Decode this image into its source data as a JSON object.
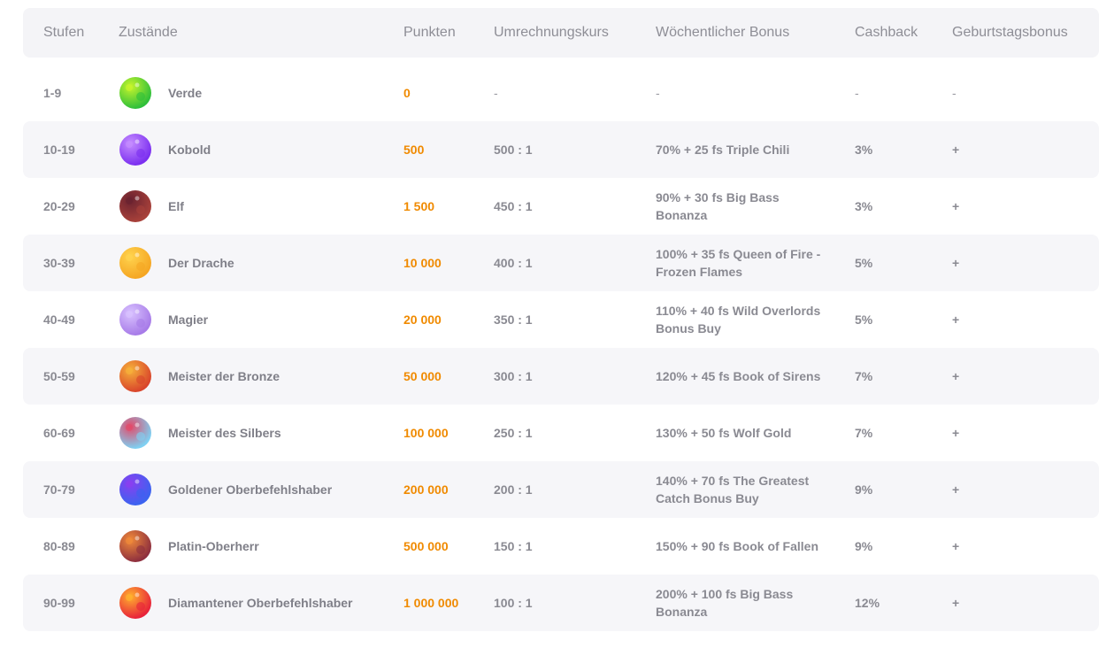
{
  "headers": {
    "level": "Stufen",
    "status": "Zustände",
    "points": "Punkten",
    "rate": "Umrechnungskurs",
    "weekly_bonus": "Wöchentlicher Bonus",
    "cashback": "Cashback",
    "birthday_bonus": "Geburtstagsbonus"
  },
  "rows": [
    {
      "level": "1-9",
      "name": "Verde",
      "points": "0",
      "rate": "-",
      "bonus": "-",
      "cashback": "-",
      "birthday": "-",
      "icon": "green-planet-icon",
      "color": "#2fbf3a",
      "accent": "#c6f52c"
    },
    {
      "level": "10-19",
      "name": "Kobold",
      "points": "500",
      "rate": "500 : 1",
      "bonus": "70% + 25 fs Triple Chili",
      "cashback": "3%",
      "birthday": "+",
      "icon": "purple-swirl-planet-icon",
      "color": "#7b2ff0",
      "accent": "#c58cff"
    },
    {
      "level": "20-29",
      "name": "Elf",
      "points": "1 500",
      "rate": "450 : 1",
      "bonus": "90% + 30 fs Big Bass Bonanza",
      "cashback": "3%",
      "birthday": "+",
      "icon": "rocky-red-planet-icon",
      "color": "#a8413a",
      "accent": "#6a2230"
    },
    {
      "level": "30-39",
      "name": "Der Drache",
      "points": "10 000",
      "rate": "400 : 1",
      "bonus": "100% + 35 fs Queen of Fire - Frozen Flames",
      "cashback": "5%",
      "birthday": "+",
      "icon": "golden-planet-icon",
      "color": "#f5a623",
      "accent": "#ffd34e"
    },
    {
      "level": "40-49",
      "name": "Magier",
      "points": "20 000",
      "rate": "350 : 1",
      "bonus": "110% + 40 fs Wild Overlords Bonus Buy",
      "cashback": "5%",
      "birthday": "+",
      "icon": "lilac-planet-icon",
      "color": "#a77be8",
      "accent": "#d9c2ff"
    },
    {
      "level": "50-59",
      "name": "Meister der Bronze",
      "points": "50 000",
      "rate": "300 : 1",
      "bonus": "120% + 45 fs Book of Sirens",
      "cashback": "7%",
      "birthday": "+",
      "icon": "bronze-planet-icon",
      "color": "#d9452b",
      "accent": "#f6b13a"
    },
    {
      "level": "60-69",
      "name": "Meister des Silbers",
      "points": "100 000",
      "rate": "250 : 1",
      "bonus": "130% + 50 fs Wolf Gold",
      "cashback": "7%",
      "birthday": "+",
      "icon": "silver-planet-icon",
      "color": "#7fd0f2",
      "accent": "#e24a6a"
    },
    {
      "level": "70-79",
      "name": "Goldener Oberbefehlshaber",
      "points": "200 000",
      "rate": "200 : 1",
      "bonus": "140% + 70 fs The Greatest Catch Bonus Buy",
      "cashback": "9%",
      "birthday": "+",
      "icon": "blue-planet-icon",
      "color": "#3b63f0",
      "accent": "#8a3ff0"
    },
    {
      "level": "80-89",
      "name": "Platin-Oberherr",
      "points": "500 000",
      "rate": "150 : 1",
      "bonus": "150% + 90 fs Book of Fallen",
      "cashback": "9%",
      "birthday": "+",
      "icon": "dark-red-planet-icon",
      "color": "#8e2f3e",
      "accent": "#f08a3a"
    },
    {
      "level": "90-99",
      "name": "Diamantener Oberbefehlshaber",
      "points": "1 000 000",
      "rate": "100 : 1",
      "bonus": "200% + 100 fs Big Bass Bonanza",
      "cashback": "12%",
      "birthday": "+",
      "icon": "red-bumpy-planet-icon",
      "color": "#e8233a",
      "accent": "#ffb02e"
    }
  ]
}
